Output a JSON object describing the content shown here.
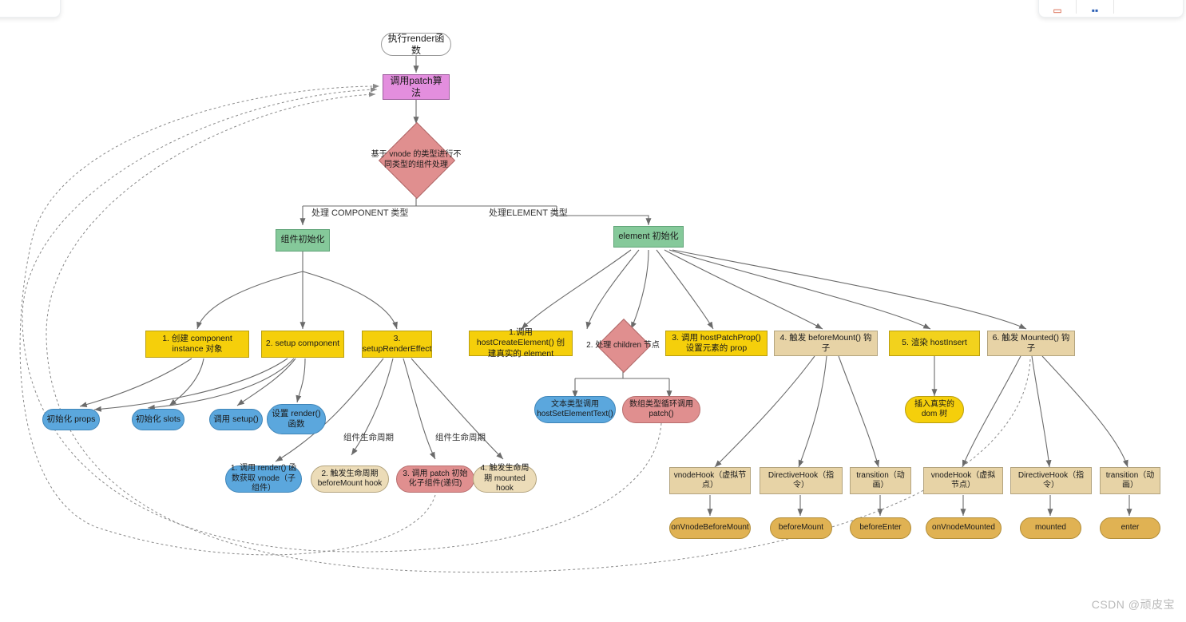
{
  "meta": {
    "watermark": "CSDN @顽皮宝"
  },
  "toolbar": {
    "icons": [
      "monitor-icon",
      "apps-icon"
    ]
  },
  "colors": {
    "magenta": "#e38ede",
    "red": "#e08f8f",
    "green": "#85c99a",
    "yellow": "#f5cf0b",
    "blue": "#5ba7dd",
    "tan": "#ecdcb8",
    "gold": "#e0b253",
    "white": "#ffffff"
  },
  "nodes": {
    "render_fn": "执行render函数",
    "patch_algo": "调用patch算法",
    "vnode_branch": "基于 vnode 的类型进行不同类型的组件处理",
    "component_init": "组件初始化",
    "element_init": "element 初始化",
    "c1": "1. 创建 component instance 对象",
    "c2": "2. setup component",
    "c3": "3. setupRenderEffect",
    "c1a": "初始化 props",
    "c1b": "初始化 slots",
    "c2a": "调用 setup()",
    "c2b": "设置 render() 函数",
    "c3a": "1. 调用 render() 函数获取 vnode（子组件）",
    "c3b": "2. 触发生命周期 beforeMount hook",
    "c3c": "3. 调用 patch 初始化子组件(递归)",
    "c3d": "4. 触发生命周期 mounted hook",
    "e1": "1.调用 hostCreateElement() 创建真实的 element",
    "e2": "2. 处理 children 节点",
    "e3": "3. 调用 hostPatchProp() 设置元素的 prop",
    "e4": "4. 触发 beforeMount() 钩子",
    "e5": "5. 渲染 hostInsert",
    "e6": "6. 触发 Mounted() 钩子",
    "e2a": "文本类型调用 hostSetElementText()",
    "e2b": "数组类型循环调用 patch()",
    "e5a": "插入真实的 dom 树",
    "h1": "vnodeHook（虚拟节点）",
    "h2": "DirectiveHook（指令）",
    "h3": "transition（动画）",
    "h4": "vnodeHook（虚拟节点）",
    "h5": "DirectiveHook（指令）",
    "h6": "transition（动画）",
    "l1": "onVnodeBeforeMount",
    "l2": "beforeMount",
    "l3": "beforeEnter",
    "l4": "onVnodeMounted",
    "l5": "mounted",
    "l6": "enter"
  },
  "edge_labels": {
    "component_type": "处理 COMPONENT 类型",
    "element_type": "处理ELEMENT 类型",
    "lifecycle_1": "组件生命周期",
    "lifecycle_2": "组件生命周期"
  }
}
